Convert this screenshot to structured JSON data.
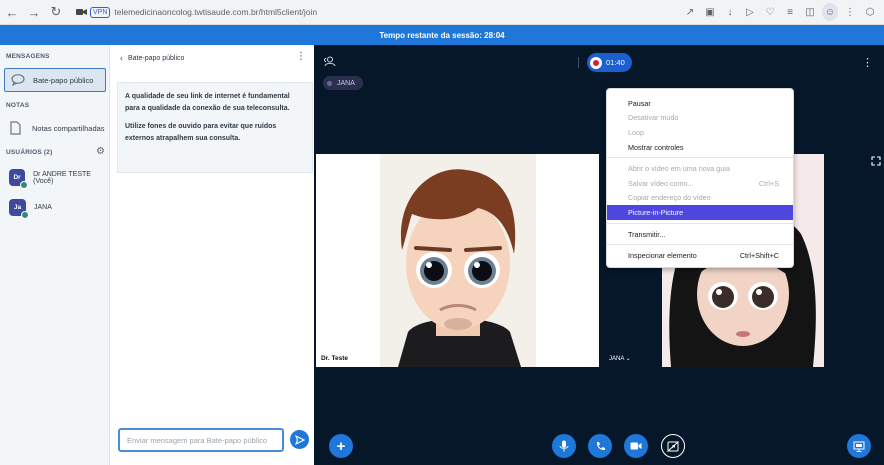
{
  "browser": {
    "url": "telemedicinaoncolog.twtisaude.com.br/html5client/join",
    "vpn_label": "VPN",
    "back_icon": "arrow-left-icon",
    "forward_icon": "arrow-right-icon",
    "reload_icon": "reload-icon"
  },
  "session_bar": {
    "text": "Tempo restante da sessão: 28:04"
  },
  "sidebar": {
    "messages_header": "MENSAGENS",
    "public_chat_label": "Bate-papo público",
    "notes_header": "NOTAS",
    "shared_notes_label": "Notas compartilhadas",
    "users_header": "USUÁRIOS (2)",
    "users": [
      {
        "initials": "Dr",
        "name": "Dr ANDRE TESTE (Você)",
        "color": "#3d4a9e"
      },
      {
        "initials": "Ja",
        "name": "JANA",
        "color": "#3d4a9e"
      }
    ]
  },
  "chat": {
    "title": "Bate-papo público",
    "welcome_p1": "A qualidade de seu link de internet é fundamental para a qualidade da conexão de sua teleconsulta.",
    "welcome_p2": "Utilize fones de ouvido para evitar que ruídos externos atrapalhem sua consulta.",
    "input_placeholder": "Enviar mensagem para Bate-papo público"
  },
  "stage": {
    "recording_time": "01:40",
    "talking_user": "JANA",
    "video1_name": "Dr. Teste",
    "video2_name": "JANA ⌄"
  },
  "context_menu": {
    "items": [
      {
        "label": "Pausar",
        "shortcut": "",
        "disabled": false
      },
      {
        "label": "Desativar mudo",
        "shortcut": "",
        "disabled": true
      },
      {
        "label": "Loop",
        "shortcut": "",
        "disabled": true
      },
      {
        "label": "Mostrar controles",
        "shortcut": "",
        "disabled": false
      },
      {
        "label": "Abrir o vídeo em uma nova guia",
        "shortcut": "",
        "disabled": true
      },
      {
        "label": "Salvar vídeo como...",
        "shortcut": "Ctrl+S",
        "disabled": true
      },
      {
        "label": "Copiar endereço do vídeo",
        "shortcut": "",
        "disabled": true
      },
      {
        "label": "Picture-in-Picture",
        "shortcut": "",
        "disabled": false,
        "highlighted": true
      },
      {
        "label": "Transmitir...",
        "shortcut": "",
        "disabled": false
      },
      {
        "label": "Inspecionar elemento",
        "shortcut": "Ctrl+Shift+C",
        "disabled": false
      }
    ]
  },
  "colors": {
    "accent": "#1e77d9",
    "stage_bg": "#06172a",
    "menu_highlight": "#4f46e0"
  }
}
